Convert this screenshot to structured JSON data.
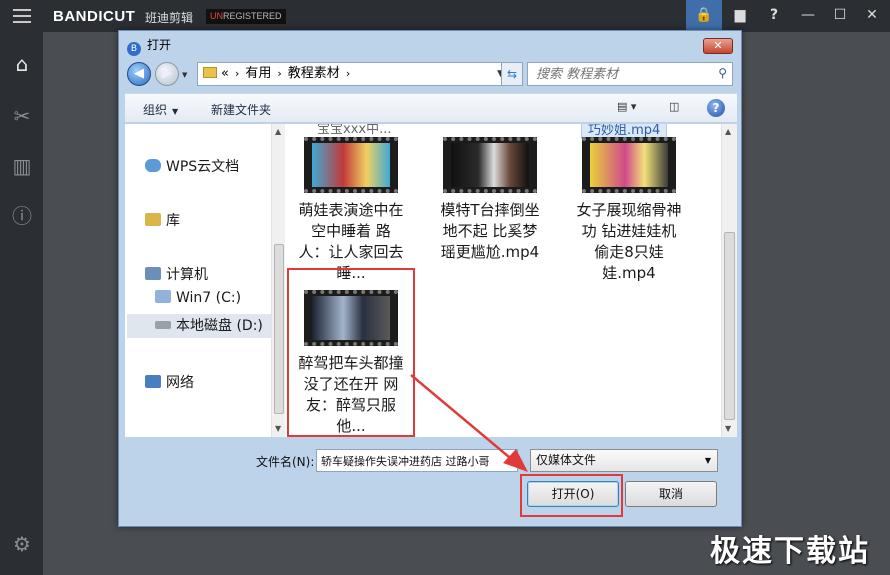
{
  "app": {
    "brand": "BANDICUT",
    "brand_cn": "班迪剪辑",
    "unreg_prefix": "UN",
    "unreg_rest": "REGISTERED"
  },
  "dialog": {
    "title": "打开",
    "close": "✕",
    "breadcrumb": [
      "«",
      "有用",
      "教程素材"
    ],
    "search_placeholder": "搜索 教程素材",
    "toolbar": {
      "organize": "组织",
      "new_folder": "新建文件夹"
    },
    "nav": [
      "WPS云文档",
      "库",
      "计算机",
      "Win7 (C:)",
      "本地磁盘 (D:)",
      "网络"
    ],
    "files": [
      {
        "name": "萌娃表演途中在空中睡着 路人：让人家回去睡...",
        "colors": [
          "#c23a3a",
          "#f0d060",
          "#3fa9d6"
        ]
      },
      {
        "name": "模特T台摔倒坐地不起 比奚梦瑶更尴尬.mp4",
        "colors": [
          "#111111",
          "#dcdcdc",
          "#6b4a3a"
        ]
      },
      {
        "name": "女子展现缩骨神功 钻进娃娃机偷走8只娃娃.mp4",
        "colors": [
          "#e8d23a",
          "#d04a8a",
          "#3a3a3a"
        ]
      },
      {
        "name": "醉驾把车头都撞没了还在开 网友：醉驾只服他...",
        "colors": [
          "#1a2230",
          "#a2b4cc",
          "#5a5a5a"
        ]
      }
    ],
    "partial_above": [
      "宝宝xxx中...",
      "巧妙姐.mp4"
    ],
    "filename_label": "文件名(N):",
    "filename_value": "轿车疑操作失误冲进药店 过路小哥",
    "filetype": "仅媒体文件",
    "open_button": "打开(O)",
    "cancel_button": "取消"
  },
  "watermark": "极速下载站"
}
